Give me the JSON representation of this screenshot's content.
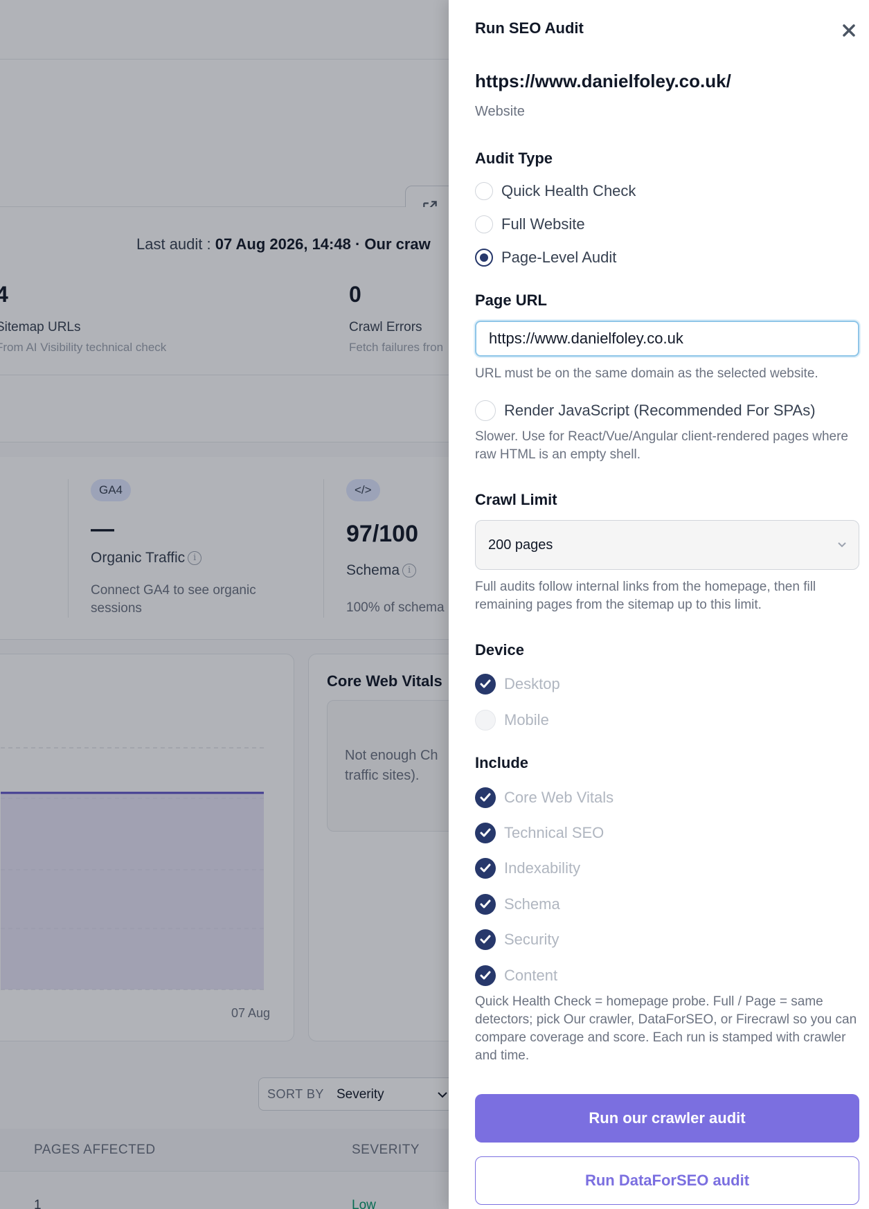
{
  "background": {
    "last_audit_label": "Last audit :",
    "last_audit_value": "07 Aug 2026, 14:48 · Our craw",
    "stats": [
      {
        "value": "4",
        "label": "Sitemap URLs",
        "sub": "From AI Visibility technical check"
      },
      {
        "value": "0",
        "label": "Crawl Errors",
        "sub": "Fetch failures fron"
      }
    ],
    "metrics": [
      {
        "badge": "GA4",
        "value": "—",
        "label": "Organic Traffic",
        "desc": "Connect GA4 to see organic sessions"
      },
      {
        "badge": "</>",
        "value": "97/100",
        "label": "Schema",
        "desc": "100% of schema"
      }
    ],
    "chart_card": {
      "x_label": "07 Aug"
    },
    "cwv_card": {
      "title": "Core Web Vitals",
      "empty_text": "Not enough Ch traffic sites)."
    },
    "sort": {
      "label": "SORT BY",
      "value": "Severity"
    },
    "table": {
      "headers": [
        "PAGES AFFECTED",
        "SEVERITY"
      ],
      "first_row": {
        "pages": "1",
        "severity": "Low"
      }
    },
    "colors": {
      "chart_line": "#5b4fc7",
      "chart_fill": "#ded9f3",
      "severity_low": "#059669"
    }
  },
  "drawer": {
    "title": "Run SEO Audit",
    "close_icon": "close-icon",
    "site_url": "https://www.danielfoley.co.uk/",
    "site_type": "Website",
    "audit_type": {
      "label": "Audit Type",
      "options": [
        "Quick Health Check",
        "Full Website",
        "Page-Level Audit"
      ],
      "selected": "Page-Level Audit"
    },
    "page_url": {
      "label": "Page URL",
      "value": "https://www.danielfoley.co.uk",
      "help": "URL must be on the same domain as the selected website."
    },
    "render_js": {
      "label": "Render JavaScript (Recommended For SPAs)",
      "checked": false,
      "help": "Slower. Use for React/Vue/Angular client-rendered pages where raw HTML is an empty shell."
    },
    "crawl_limit": {
      "label": "Crawl Limit",
      "value": "200 pages",
      "help": "Full audits follow internal links from the homepage, then fill remaining pages from the sitemap up to this limit."
    },
    "device": {
      "label": "Device",
      "options": [
        {
          "label": "Desktop",
          "checked": true
        },
        {
          "label": "Mobile",
          "checked": false
        }
      ]
    },
    "include": {
      "label": "Include",
      "options": [
        {
          "label": "Core Web Vitals",
          "checked": true
        },
        {
          "label": "Technical SEO",
          "checked": true
        },
        {
          "label": "Indexability",
          "checked": true
        },
        {
          "label": "Schema",
          "checked": true
        },
        {
          "label": "Security",
          "checked": true
        },
        {
          "label": "Content",
          "checked": true
        }
      ]
    },
    "footer_note": "Quick Health Check = homepage probe. Full / Page = same detectors; pick Our crawler, DataForSEO, or Firecrawl so you can compare coverage and score. Each run is stamped with crawler and time.",
    "buttons": {
      "primary": "Run our crawler audit",
      "secondary": "Run DataForSEO audit"
    },
    "colors": {
      "accent": "#7b6fe0",
      "check_fill": "#27386b",
      "input_focus": "#8ec5e8"
    }
  }
}
